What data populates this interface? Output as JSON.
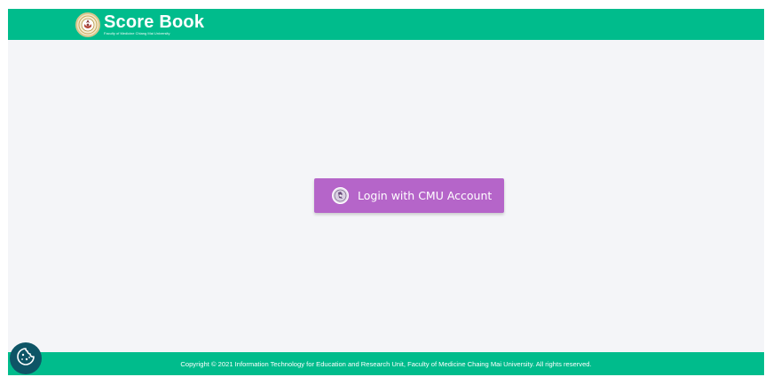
{
  "header": {
    "title": "Score Book",
    "subtitle": "Faculty of Medicine Chiang Mai University",
    "logo_icon": "cmu-medicine-seal-icon",
    "background": "#00bc8c"
  },
  "main": {
    "login_button": {
      "label": "Login with CMU Account",
      "icon": "cmu-seal-icon",
      "color": "#b565c9"
    }
  },
  "footer": {
    "copyright": "Copyright © 2021 Information Technology for Education and Research Unit, Faculty of Medicine Chaing Mai University. All rights reserved.",
    "background": "#00bc8c"
  },
  "cookie_button": {
    "icon": "cookie-icon",
    "color": "#0e5566"
  }
}
